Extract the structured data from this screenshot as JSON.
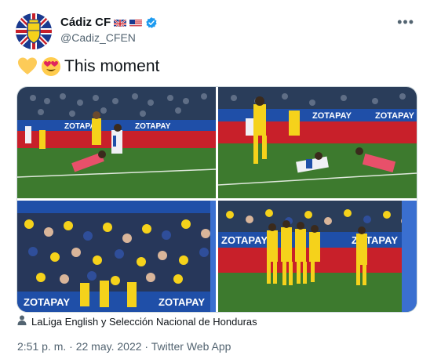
{
  "account": {
    "name": "Cádiz CF",
    "handle": "@Cadiz_CFEN",
    "avatar_icon": "cadiz-crest-icon",
    "flags": [
      "uk-flag-icon",
      "us-flag-icon"
    ],
    "verified_icon": "verified-badge-icon"
  },
  "tweet": {
    "emojis": [
      "yellow-heart-icon",
      "heart-eyes-emoji-icon"
    ],
    "text": "This moment"
  },
  "media": {
    "photos": [
      {
        "name": "photo-match-action-1",
        "ad_text": "ZOTAPAY"
      },
      {
        "name": "photo-match-action-2",
        "ad_text": "ZOTAPAY"
      },
      {
        "name": "photo-fans-celebration",
        "ad_text": "ZOTAPAY"
      },
      {
        "name": "photo-team-celebration",
        "ad_text": "ZOTAPAY"
      }
    ]
  },
  "tagged": {
    "icon": "person-tag-icon",
    "text": "LaLiga English y Selección Nacional de Honduras"
  },
  "meta": {
    "time": "2:51 p. m.",
    "separator": "·",
    "date": "22 may. 2022",
    "source": "Twitter Web App"
  },
  "colors": {
    "pitch": "#3d7a2e",
    "board_blue": "#1f4fa8",
    "board_red": "#c8202a",
    "cadiz_yellow": "#f5d21b",
    "verified": "#1d9bf0"
  }
}
